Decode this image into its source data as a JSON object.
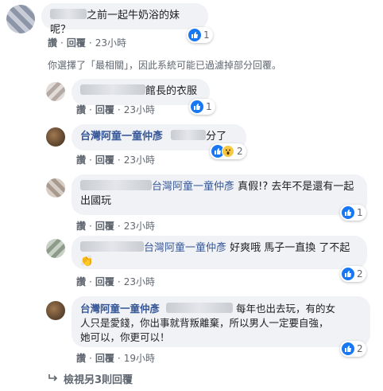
{
  "comments": [
    {
      "author_blurred": true,
      "text": "之前一起牛奶浴的妹呢？",
      "actions": [
        "讚",
        "回覆"
      ],
      "time": "23小時",
      "reactions": {
        "types": [
          "like"
        ],
        "count": "1"
      }
    },
    {
      "author_blurred": true,
      "text": "館長的衣服",
      "actions": [
        "讚",
        "回覆"
      ],
      "time": "23小時",
      "reactions": {
        "types": [
          "like"
        ],
        "count": "1"
      }
    },
    {
      "author": "台灣阿童一童仲彥",
      "tag_blurred": true,
      "text": "分了",
      "actions": [
        "讚",
        "回覆"
      ],
      "time": "23小時",
      "reactions": {
        "types": [
          "like",
          "wow"
        ],
        "count": "2"
      }
    },
    {
      "author_blurred": true,
      "tag": "台灣阿童一童仲彥",
      "text_line1": "真假!? 去年不是還有一起",
      "text_line2": "出國玩",
      "actions": [
        "讚",
        "回覆"
      ],
      "time": "23小時",
      "reactions": {
        "types": [
          "like"
        ],
        "count": "1"
      }
    },
    {
      "author_blurred": true,
      "tag": "台灣阿童一童仲彥",
      "text": "好爽哦 馬子一直換 了不起",
      "emoji": "clapping-hands",
      "actions": [
        "讚",
        "回覆"
      ],
      "time": "23小時",
      "reactions": {
        "types": [
          "like"
        ],
        "count": "2"
      }
    },
    {
      "author": "台灣阿童一童仲彥",
      "tag_blurred": true,
      "text_line1": "每年也出去玩，有的女",
      "text_line2": "人只是愛錢，你出事就背叛離棄，所以男人一定要自強，",
      "text_line3": "她可以，你更可以！",
      "actions": [
        "讚",
        "回覆"
      ],
      "time": "19小時",
      "reactions": {
        "types": [
          "like"
        ],
        "count": "2"
      }
    }
  ],
  "filter_notice": "你選擇了「最相關」，因此系統可能已過濾掉部分回覆。",
  "view_more": "檢視另3則回覆",
  "colors": {
    "link": "#385898",
    "bubble": "#f0f2f5",
    "like": "#1877f2",
    "meta": "#606770"
  }
}
